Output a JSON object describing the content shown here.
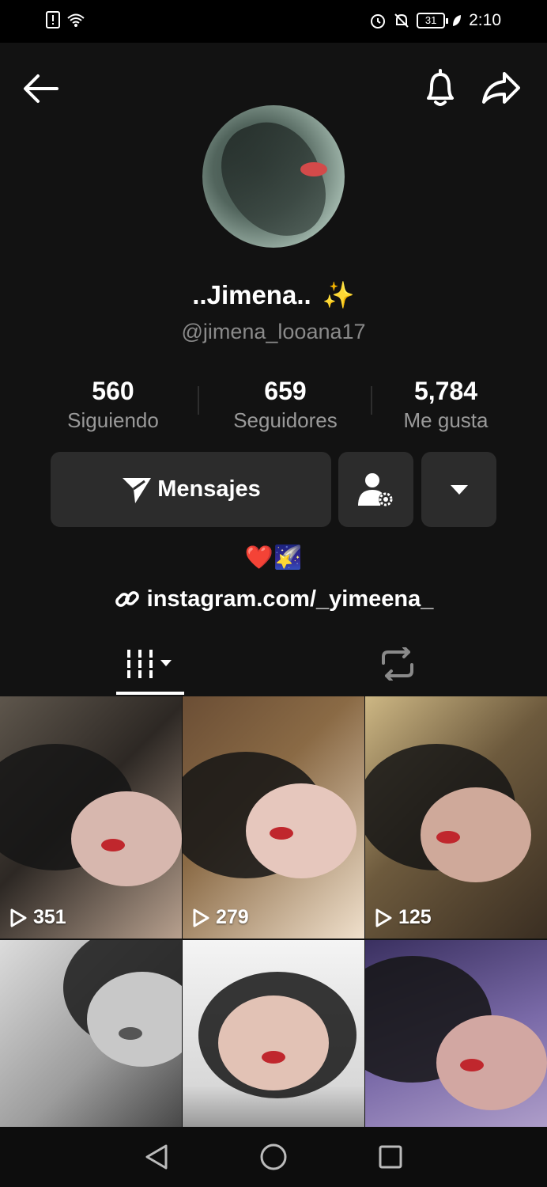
{
  "status_bar": {
    "time": "2:10",
    "battery": "31"
  },
  "profile": {
    "display_name": "..Jimena..",
    "name_emoji": "✨",
    "username": "@jimena_looana17",
    "avatar_icon": "avatar"
  },
  "stats": [
    {
      "value": "560",
      "label": "Siguiendo"
    },
    {
      "value": "659",
      "label": "Seguidores"
    },
    {
      "value": "5,784",
      "label": "Me gusta"
    }
  ],
  "actions": {
    "message_label": "Mensajes"
  },
  "bio": {
    "emoji_heart": "❤️",
    "emoji_star": "🌠",
    "link": "instagram.com/_yimeena_"
  },
  "videos": [
    {
      "views": "351"
    },
    {
      "views": "279"
    },
    {
      "views": "125"
    },
    {
      "views": ""
    },
    {
      "views": ""
    },
    {
      "views": ""
    }
  ],
  "colors": {
    "background": "#121212",
    "button": "#2c2c2c",
    "muted_text": "#8a8a8a"
  }
}
